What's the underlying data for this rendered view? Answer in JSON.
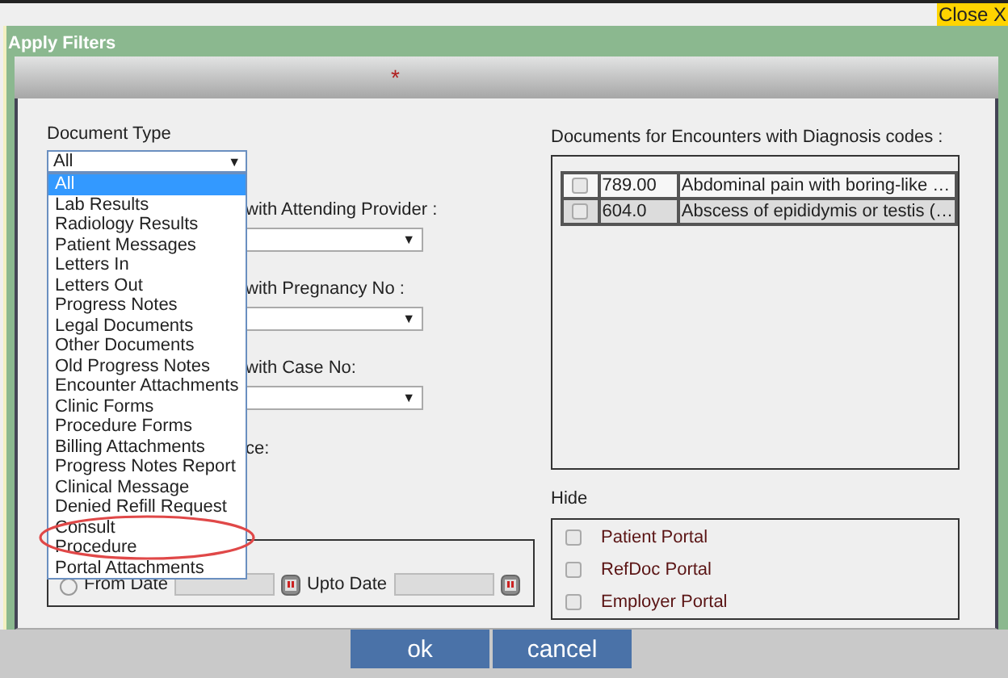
{
  "close_button": "Close X",
  "dialog": {
    "title": "Apply Filters",
    "required_mark": "*"
  },
  "document_type": {
    "label": "Document Type",
    "value": "All",
    "caret": "▼",
    "options": [
      {
        "label": "All",
        "selected": true
      },
      {
        "label": "Lab Results",
        "selected": false
      },
      {
        "label": "Radiology Results",
        "selected": false
      },
      {
        "label": "Patient Messages",
        "selected": false
      },
      {
        "label": "Letters In",
        "selected": false
      },
      {
        "label": "Letters Out",
        "selected": false
      },
      {
        "label": "Progress Notes",
        "selected": false
      },
      {
        "label": "Legal Documents",
        "selected": false
      },
      {
        "label": "Other Documents",
        "selected": false
      },
      {
        "label": "Old Progress Notes",
        "selected": false
      },
      {
        "label": "Encounter Attachments",
        "selected": false
      },
      {
        "label": "Clinic Forms",
        "selected": false
      },
      {
        "label": "Procedure Forms",
        "selected": false
      },
      {
        "label": "Billing Attachments",
        "selected": false
      },
      {
        "label": "Progress Notes Report",
        "selected": false
      },
      {
        "label": "Clinical Message",
        "selected": false
      },
      {
        "label": "Denied Refill Request",
        "selected": false
      },
      {
        "label": "Consult",
        "selected": false
      },
      {
        "label": "Procedure",
        "selected": false
      },
      {
        "label": "Portal Attachments",
        "selected": false
      }
    ]
  },
  "filters": [
    {
      "label": "with Attending Provider :",
      "caret": "▼"
    },
    {
      "label": "with Pregnancy No :",
      "caret": "▼"
    },
    {
      "label": "with Case No:",
      "caret": "▼"
    }
  ],
  "date_range": {
    "label": "ce:",
    "from_selected": false,
    "from_label": "From Date",
    "to_label": "Upto Date"
  },
  "diagnosis": {
    "label": "Documents for Encounters with Diagnosis codes :",
    "rows": [
      {
        "checked": false,
        "code": "789.00",
        "description": "Abdominal pain with boring-like …"
      },
      {
        "checked": false,
        "code": "604.0",
        "description": "Abscess of epididymis or testis (…"
      }
    ]
  },
  "hide": {
    "label": "Hide",
    "options": [
      {
        "label": "Patient Portal",
        "checked": false
      },
      {
        "label": "RefDoc Portal",
        "checked": false
      },
      {
        "label": "Employer Portal",
        "checked": false
      }
    ]
  },
  "buttons": [
    {
      "label": "ok"
    },
    {
      "label": "cancel"
    }
  ]
}
